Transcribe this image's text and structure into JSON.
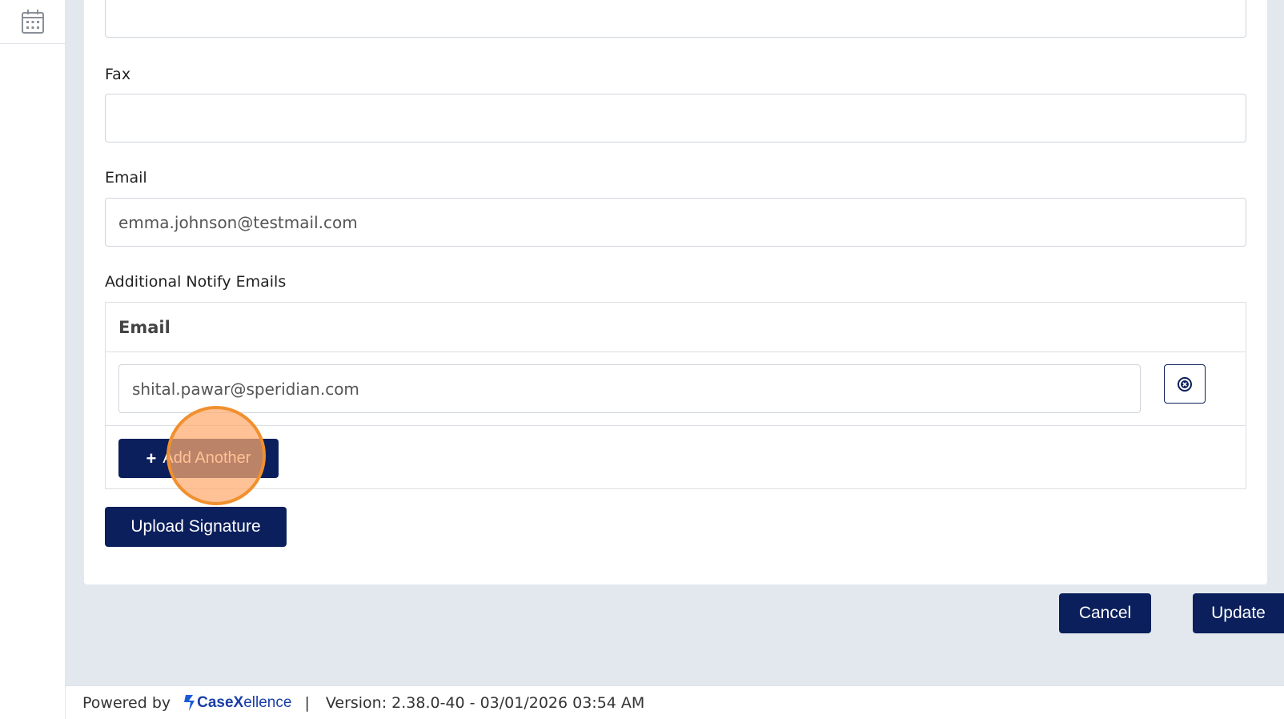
{
  "sidebar": {
    "calendar_icon": "calendar-icon"
  },
  "form": {
    "fax": {
      "label": "Fax",
      "value": ""
    },
    "email": {
      "label": "Email",
      "value": "emma.johnson@testmail.com"
    },
    "additional": {
      "label": "Additional Notify Emails",
      "column_header": "Email",
      "rows": [
        {
          "value": "shital.pawar@speridian.com"
        }
      ],
      "add_label": "Add Another"
    },
    "upload_label": "Upload Signature"
  },
  "actions": {
    "cancel_label": "Cancel",
    "update_label": "Update"
  },
  "footer": {
    "powered_by": "Powered by",
    "brand_case": "CaseX",
    "brand_rest": "ellence",
    "separator": "|",
    "version": "Version: 2.38.0-40 - 03/01/2026 03:54 AM"
  },
  "colors": {
    "navy": "#0b1f5c",
    "background": "#e3e8ef",
    "highlight": "#f0902e"
  }
}
